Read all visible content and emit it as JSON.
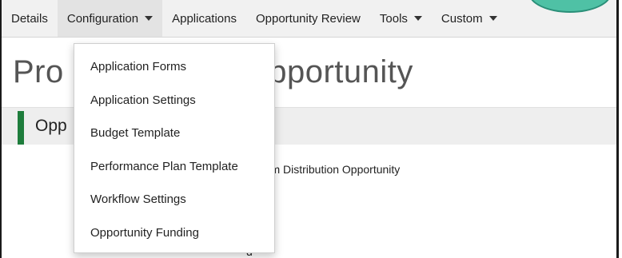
{
  "navbar": {
    "items": [
      {
        "label": "Details",
        "has_caret": false
      },
      {
        "label": "Configuration",
        "has_caret": true
      },
      {
        "label": "Applications",
        "has_caret": false
      },
      {
        "label": "Opportunity Review",
        "has_caret": false
      },
      {
        "label": "Tools",
        "has_caret": true
      },
      {
        "label": "Custom",
        "has_caret": true
      }
    ]
  },
  "page": {
    "title_left": "Pro",
    "title_right": "ution Opportunity",
    "section_title": "Opp",
    "body_text": "ram Distribution Opportunity",
    "trailing_char": "d"
  },
  "dropdown": {
    "items": [
      "Application Forms",
      "Application Settings",
      "Budget Template",
      "Performance Plan Template",
      "Workflow Settings",
      "Opportunity Funding"
    ]
  },
  "colors": {
    "navbar_bg": "#f1f1f1",
    "section_accent": "#1e7d3c",
    "badge": "#4fc1a5",
    "link_blue": "#2a5db0"
  }
}
